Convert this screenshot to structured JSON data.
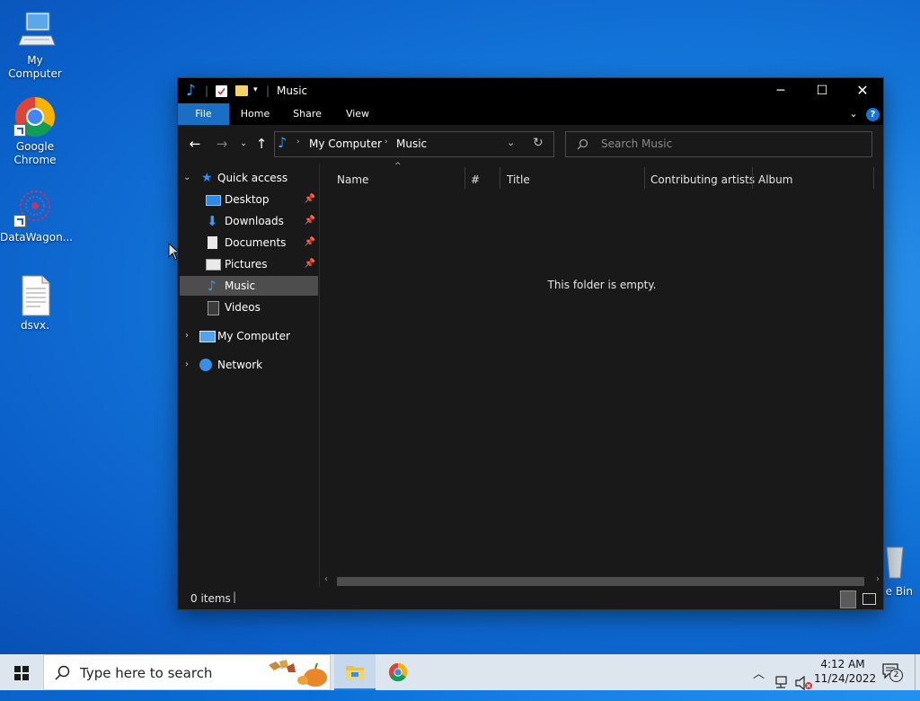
{
  "desktop": {
    "icons": [
      {
        "label": "My Computer"
      },
      {
        "label": "Google Chrome"
      },
      {
        "label": "DataWagon..."
      },
      {
        "label": "dsvx."
      },
      {
        "label": "e Bin"
      }
    ]
  },
  "window": {
    "title": "Music",
    "ribbon_tabs": [
      "File",
      "Home",
      "Share",
      "View"
    ],
    "help_label": "?",
    "breadcrumb": [
      "My Computer",
      "Music"
    ],
    "search_placeholder": "Search Music",
    "nav": {
      "quick_access": "Quick access",
      "items": [
        {
          "label": "Desktop",
          "pinned": true
        },
        {
          "label": "Downloads",
          "pinned": true
        },
        {
          "label": "Documents",
          "pinned": true
        },
        {
          "label": "Pictures",
          "pinned": true
        },
        {
          "label": "Music",
          "pinned": false
        },
        {
          "label": "Videos",
          "pinned": false
        }
      ],
      "my_computer": "My Computer",
      "network": "Network"
    },
    "columns": [
      "Name",
      "#",
      "Title",
      "Contributing artists",
      "Album"
    ],
    "empty_message": "This folder is empty.",
    "status_items": "0 items"
  },
  "taskbar": {
    "search_placeholder": "Type here to search",
    "time": "4:12 AM",
    "date": "11/24/2022",
    "notification_count": "2"
  },
  "colors": {
    "accent": "#0078d7",
    "window_bg": "#191919",
    "selection": "#4d4d4d"
  }
}
